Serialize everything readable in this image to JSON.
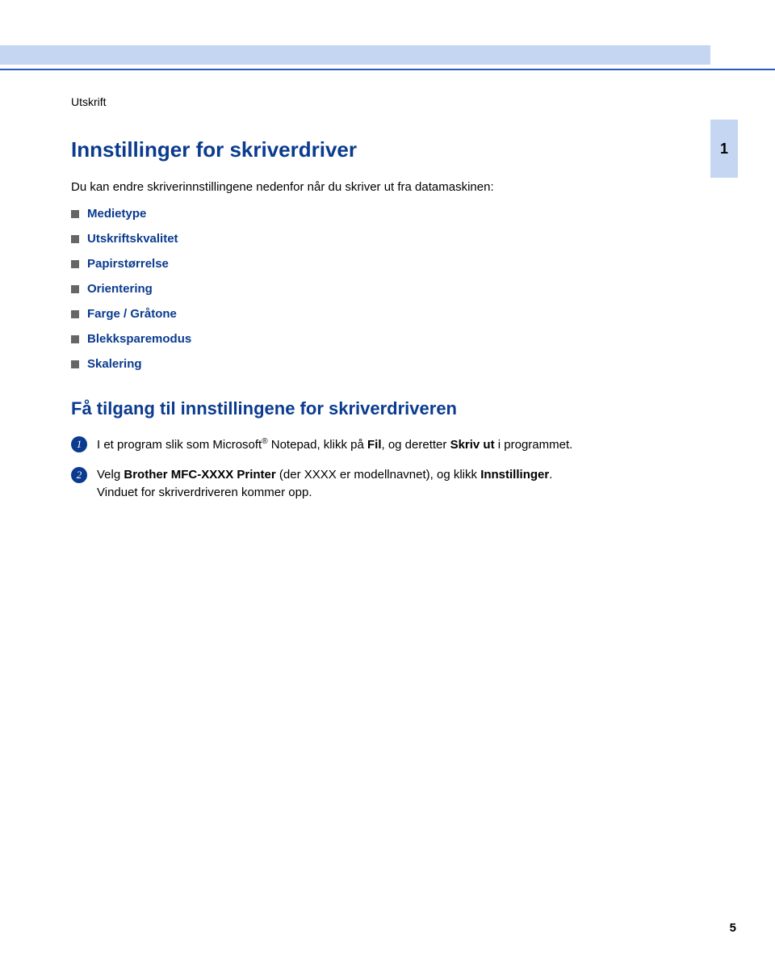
{
  "section_label": "Utskrift",
  "heading1": "Innstillinger for skriverdriver",
  "intro": "Du kan endre skriverinnstillingene nedenfor når du skriver ut fra datamaskinen:",
  "bullets": [
    "Medietype",
    "Utskriftskvalitet",
    "Papirstørrelse",
    "Orientering",
    "Farge / Gråtone",
    "Blekksparemodus",
    "Skalering"
  ],
  "heading2": "Få tilgang til innstillingene for skriverdriveren",
  "steps": [
    {
      "num": "1",
      "parts": [
        {
          "text": "I et program slik som Microsoft",
          "bold": false
        },
        {
          "text": "®",
          "sup": true
        },
        {
          "text": " Notepad, klikk på ",
          "bold": false
        },
        {
          "text": "Fil",
          "bold": true
        },
        {
          "text": ", og deretter ",
          "bold": false
        },
        {
          "text": "Skriv ut",
          "bold": true
        },
        {
          "text": " i programmet.",
          "bold": false
        }
      ]
    },
    {
      "num": "2",
      "parts": [
        {
          "text": "Velg ",
          "bold": false
        },
        {
          "text": "Brother MFC-XXXX Printer",
          "bold": true
        },
        {
          "text": " (der XXXX er modellnavnet), og klikk ",
          "bold": false
        },
        {
          "text": "Innstillinger",
          "bold": true
        },
        {
          "text": ".",
          "bold": false
        }
      ],
      "after": "Vinduet for skriverdriveren kommer opp."
    }
  ],
  "side_tab": "1",
  "page_number": "5"
}
